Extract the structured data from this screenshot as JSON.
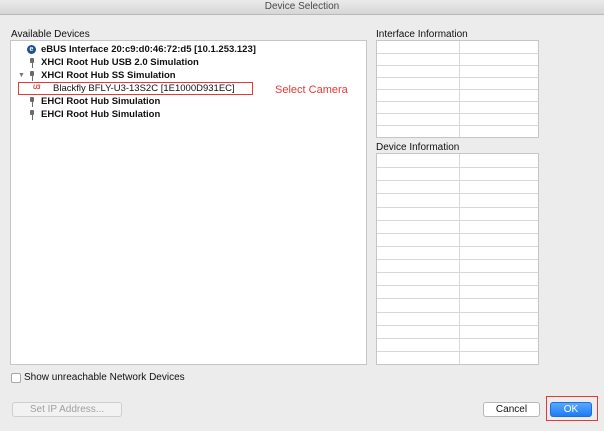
{
  "window": {
    "title": "Device Selection"
  },
  "devices": {
    "label": "Available Devices",
    "tree": [
      {
        "text": "eBUS Interface 20:c9:d0:46:72:d5 [10.1.253.123]",
        "bold": true,
        "icon": "ebus-icon",
        "icon_glyph": "e",
        "disclosure": ""
      },
      {
        "text": "XHCI Root Hub USB 2.0 Simulation",
        "bold": true,
        "icon": "usb-icon",
        "disclosure": ""
      },
      {
        "text": "XHCI Root Hub SS Simulation",
        "bold": true,
        "icon": "usb-icon",
        "disclosure": "▼"
      },
      {
        "text": "Blackfly BFLY-U3-13S2C [1E1000D931EC]",
        "bold": false,
        "icon": "usb3-camera-icon",
        "icon_glyph": "U3",
        "disclosure": ""
      },
      {
        "text": "EHCI Root Hub Simulation",
        "bold": true,
        "icon": "usb-icon",
        "disclosure": ""
      },
      {
        "text": "EHCI Root Hub Simulation",
        "bold": true,
        "icon": "usb-icon",
        "disclosure": ""
      }
    ],
    "annotation": "Select Camera"
  },
  "interface_info": {
    "label": "Interface Information",
    "rows": 8
  },
  "device_info": {
    "label": "Device Information",
    "rows": 16
  },
  "options": {
    "show_unreachable_label": "Show unreachable Network Devices",
    "show_unreachable_checked": false
  },
  "buttons": {
    "set_ip": "Set IP Address...",
    "cancel": "Cancel",
    "ok": "OK"
  },
  "colors": {
    "annotation": "#e53935",
    "primary_button": "#1e7cf2"
  }
}
